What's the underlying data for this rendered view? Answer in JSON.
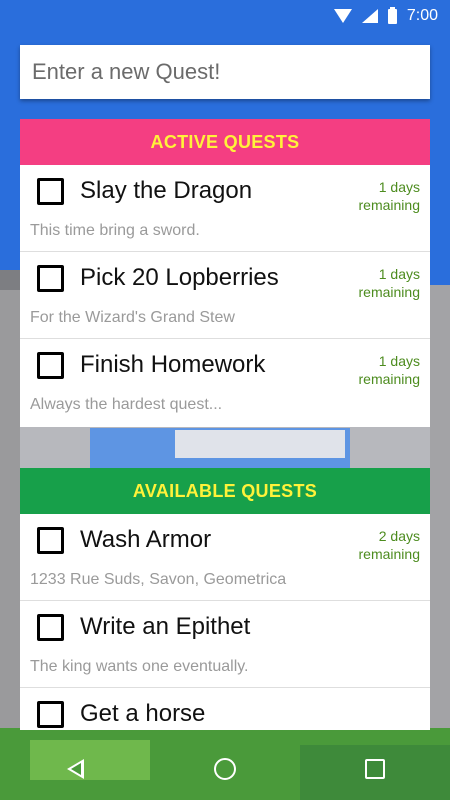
{
  "status_bar": {
    "time": "7:00",
    "icons": [
      "wifi-icon",
      "signal-icon",
      "battery-icon"
    ]
  },
  "input": {
    "placeholder": "Enter a new Quest!",
    "value": ""
  },
  "active": {
    "header": "ACTIVE QUESTS",
    "color": "#f43e82",
    "quests": [
      {
        "title": "Slay the Dragon",
        "remaining_line1": "1 days",
        "remaining_line2": "remaining",
        "desc": "This time bring a sword."
      },
      {
        "title": "Pick 20 Lopberries",
        "remaining_line1": "1 days",
        "remaining_line2": "remaining",
        "desc": "For the Wizard's Grand Stew"
      },
      {
        "title": "Finish Homework",
        "remaining_line1": "1 days",
        "remaining_line2": "remaining",
        "desc": "Always the hardest quest..."
      }
    ]
  },
  "available": {
    "header": "AVAILABLE QUESTS",
    "color": "#17a04a",
    "quests": [
      {
        "title": "Wash Armor",
        "remaining_line1": "2 days",
        "remaining_line2": "remaining",
        "desc": "1233 Rue Suds, Savon, Geometrica"
      },
      {
        "title": "Write an Epithet",
        "remaining_line1": "",
        "remaining_line2": "",
        "desc": "The king wants one eventually."
      },
      {
        "title": "Get a horse",
        "remaining_line1": "",
        "remaining_line2": "",
        "desc": ""
      }
    ]
  },
  "header_text_color": "#fff23a",
  "nav": {
    "buttons": [
      "back-icon",
      "home-icon",
      "recents-icon"
    ]
  }
}
